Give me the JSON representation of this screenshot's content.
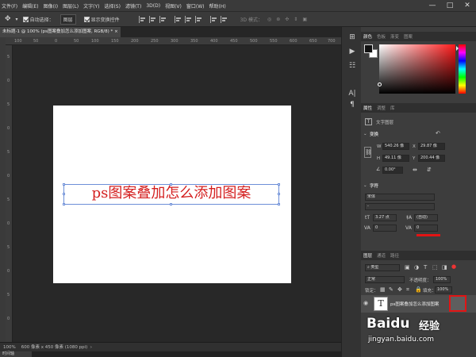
{
  "menu": {
    "items": [
      "文件(F)",
      "编辑(E)",
      "图像(I)",
      "图层(L)",
      "文字(Y)",
      "选择(S)",
      "滤镜(T)",
      "3D(D)",
      "视图(V)",
      "窗口(W)",
      "帮助(H)"
    ],
    "window_controls": [
      "—",
      "□",
      "✕"
    ]
  },
  "options_bar": {
    "auto_select_label": "自动选择：",
    "auto_select_value": "图层",
    "show_transform_label": "显示变换控件",
    "mode3d_label": "3D 模式："
  },
  "document": {
    "tab_title": "未标题-1 @ 100% (ps图案叠加怎么添加图案, RGB/8) *",
    "close_glyph": "×",
    "canvas_text": "ps图案叠加怎么添加图案",
    "status_zoom": "100%",
    "status_info": "600 像素 x 450 像素 (1080 ppi)",
    "bottom_tab": "时间轴"
  },
  "ruler": {
    "h_ticks": [
      "100",
      "50",
      "0",
      "50",
      "100",
      "150",
      "200",
      "250",
      "300",
      "350",
      "400",
      "450",
      "500",
      "550",
      "600",
      "650",
      "700"
    ],
    "v_ticks": [
      "5",
      "0",
      "5",
      "0",
      "5",
      "0",
      "5",
      "0",
      "5",
      "0",
      "5",
      "0"
    ]
  },
  "color_panel": {
    "tabs": [
      "颜色",
      "色板",
      "渐变",
      "图案"
    ],
    "foreground": "#111111",
    "background": "#ffffff"
  },
  "properties_panel": {
    "tabs": [
      "属性",
      "调整",
      "库"
    ],
    "layer_type": "文字图层",
    "transform_title": "变换",
    "w_label": "W",
    "w_value": "540.26 像",
    "x_label": "X",
    "x_value": "29.87 像",
    "h_label": "H",
    "h_value": "49.11 像",
    "y_label": "Y",
    "y_value": "200.44 像",
    "angle_value": "0.00°",
    "char_title": "字符",
    "font_family": "宋体",
    "font_style": "-",
    "font_size": "3.27 点",
    "leading": "(自动)",
    "kerning": "0",
    "tracking": "0"
  },
  "layers_panel": {
    "tabs": [
      "图层",
      "通道",
      "路径"
    ],
    "filter_label": "类型",
    "blend_mode": "正常",
    "opacity_label": "不透明度：",
    "opacity_value": "100%",
    "lock_label": "锁定：",
    "fill_label": "填充：",
    "fill_value": "100%",
    "layer_name": "ps图案叠加怎么添加图案",
    "layer_thumb": "T"
  },
  "watermark": {
    "logo": "Baidu",
    "cn": "经验",
    "url": "jingyan.baidu.com"
  },
  "colors": {
    "accent_red": "#e21414",
    "canvas_text": "#d41f1f",
    "selection_blue": "#6d8fd8"
  }
}
